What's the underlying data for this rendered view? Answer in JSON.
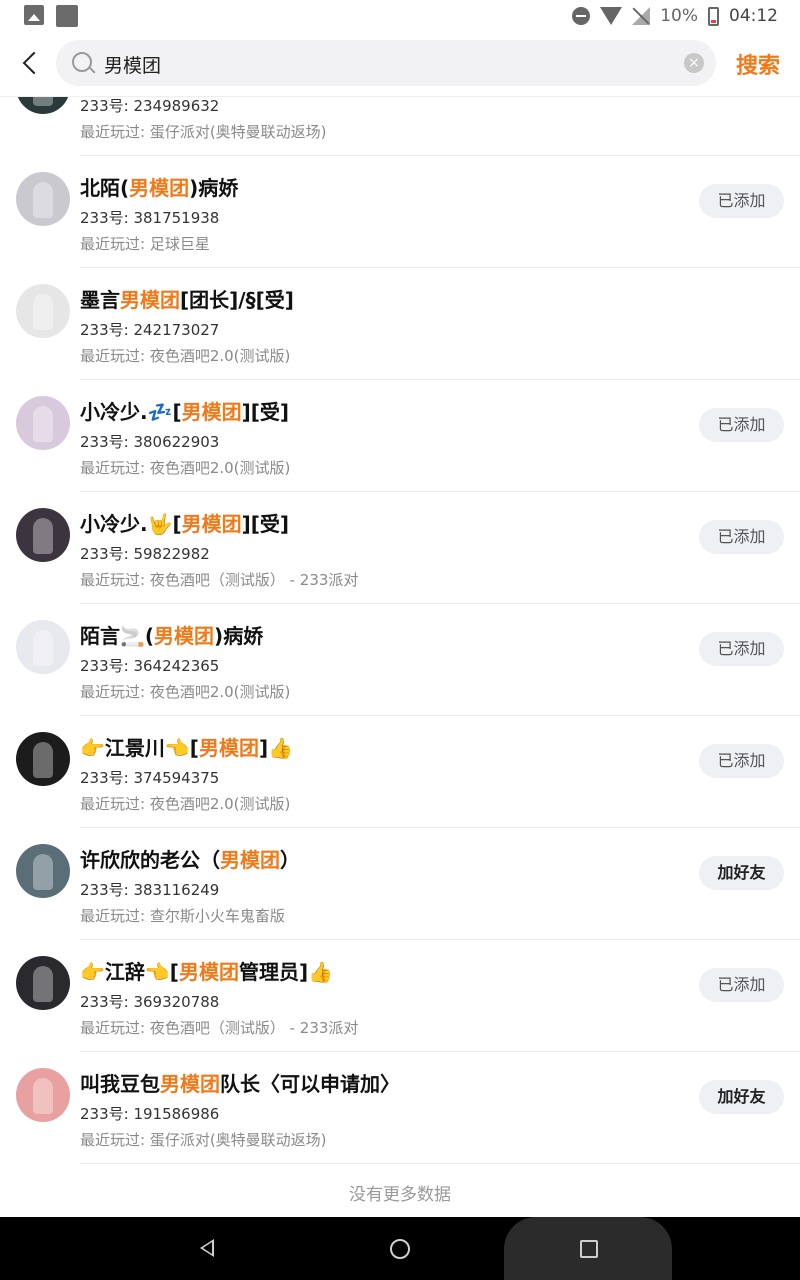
{
  "status_bar": {
    "battery": "10%",
    "time": "04:12"
  },
  "header": {
    "search_query": "男模团",
    "search_button": "搜索"
  },
  "results": [
    {
      "name_parts": [
        "",
        "",
        ""
      ],
      "uid": "233号: 234989632",
      "recent": "最近玩过: 蛋仔派对(奥特曼联动返场)",
      "action": "",
      "avatar_color": "#2a3a3a"
    },
    {
      "name_parts": [
        "北陌(",
        "男模团",
        ")病娇"
      ],
      "uid": "233号: 381751938",
      "recent": "最近玩过: 足球巨星",
      "action": "已添加",
      "avatar_color": "#c9c9cf"
    },
    {
      "name_parts": [
        "墨言",
        "男模团",
        "[团长]/§[受]"
      ],
      "uid": "233号: 242173027",
      "recent": "最近玩过: 夜色酒吧2.0(测试版)",
      "action": "",
      "avatar_color": "#e6e6e6"
    },
    {
      "name_parts": [
        "小冷少.💤[",
        "男模团",
        "][受]"
      ],
      "uid": "233号: 380622903",
      "recent": "最近玩过: 夜色酒吧2.0(测试版)",
      "action": "已添加",
      "avatar_color": "#d9c9dd"
    },
    {
      "name_parts": [
        "小冷少.🤟[",
        "男模团",
        "][受]"
      ],
      "uid": "233号: 59822982",
      "recent": "最近玩过: 夜色酒吧（测试版） - 233派对",
      "action": "已添加",
      "avatar_color": "#3c3540"
    },
    {
      "name_parts": [
        "陌言🚬(",
        "男模团",
        ")病娇"
      ],
      "uid": "233号: 364242365",
      "recent": "最近玩过: 夜色酒吧2.0(测试版)",
      "action": "已添加",
      "avatar_color": "#e8e8ef"
    },
    {
      "name_parts": [
        "👉江景川👈[",
        "男模团",
        "]👍"
      ],
      "uid": "233号: 374594375",
      "recent": "最近玩过: 夜色酒吧2.0(测试版)",
      "action": "已添加",
      "avatar_color": "#1c1c1c"
    },
    {
      "name_parts": [
        "许欣欣的老公（",
        "男模团",
        "）"
      ],
      "uid": "233号: 383116249",
      "recent": "最近玩过: 查尔斯小火车鬼畜版",
      "action": "加好友",
      "avatar_color": "#5a6e78"
    },
    {
      "name_parts": [
        "👉江辞👈[",
        "男模团",
        "管理员]👍"
      ],
      "uid": "233号: 369320788",
      "recent": "最近玩过: 夜色酒吧（测试版） - 233派对",
      "action": "已添加",
      "avatar_color": "#2a2a2e"
    },
    {
      "name_parts": [
        "叫我豆包",
        "男模团",
        "队长〈可以申请加〉"
      ],
      "uid": "233号: 191586986",
      "recent": "最近玩过: 蛋仔派对(奥特曼联动返场)",
      "action": "加好友",
      "avatar_color": "#e9a0a0"
    }
  ],
  "footer": {
    "no_more": "没有更多数据"
  },
  "colors": {
    "accent": "#f07a1a"
  }
}
